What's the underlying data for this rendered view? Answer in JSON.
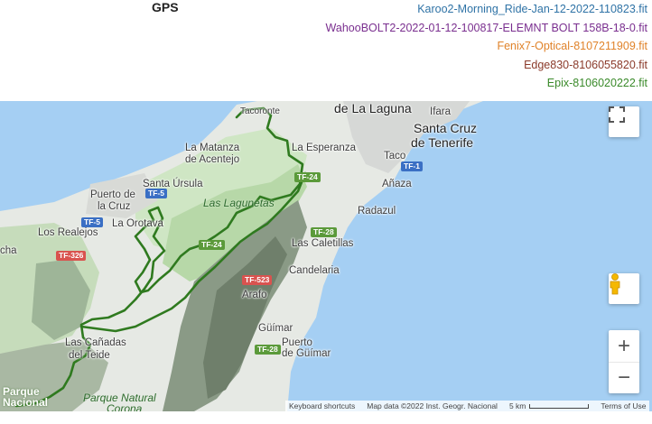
{
  "title": "GPS",
  "legend": [
    {
      "label": "Karoo2-Morning_Ride-Jan-12-2022-110823.fit",
      "color": "#2f73a6"
    },
    {
      "label": "WahooBOLT2-2022-01-12-100817-ELEMNT BOLT 158B-18-0.fit",
      "color": "#7a2f8f"
    },
    {
      "label": "Fenix7-Optical-8107211909.fit",
      "color": "#e0832a"
    },
    {
      "label": "Edge830-8106055820.fit",
      "color": "#8b3a2a"
    },
    {
      "label": "Epix-8106020222.fit",
      "color": "#3a8a2a"
    }
  ],
  "map": {
    "places": {
      "la_laguna": "de La Laguna",
      "santa_cruz_1": "Santa Cruz",
      "santa_cruz_2": "de Tenerife",
      "tacoronte": "Tacoronte",
      "matanza_1": "La Matanza",
      "matanza_2": "de Acentejo",
      "esperanza": "La Esperanza",
      "taco": "Taco",
      "anaza": "Añaza",
      "santa_ursula": "Santa Úrsula",
      "puerto_1": "Puerto de",
      "puerto_2": "la Cruz",
      "orotava": "La Orotava",
      "realejos": "Los Realejos",
      "las_lagunetas": "Las Lagunetas",
      "radazul": "Radazul",
      "caletillas": "Las Caletillas",
      "candelaria": "Candelaria",
      "arafo": "Arafo",
      "guimar": "Güímar",
      "puerto_guimar_1": "Puerto",
      "puerto_guimar_2": "de Güímar",
      "canadas_1": "Las Cañadas",
      "canadas_2": "del Teide",
      "parque_1": "Parque Natural",
      "parque_2": "Corona",
      "parque_nacional_1": "Parque",
      "parque_nacional_2": "Nacional",
      "icod": "cha",
      "ifara": "Ifara"
    },
    "roads": {
      "tf1": "TF-1",
      "tf5a": "TF-5",
      "tf5b": "TF-5",
      "tf24a": "TF-24",
      "tf24b": "TF-24",
      "tf24c": "TF-24",
      "tf28a": "TF-28",
      "tf28b": "TF-28",
      "tf523": "TF-523",
      "tf326": "TF-326"
    },
    "track_color": "#2f7a1f",
    "footer": {
      "shortcuts": "Keyboard shortcuts",
      "attribution": "Map data ©2022 Inst. Geogr. Nacional",
      "scale": "5 km",
      "terms": "Terms of Use"
    },
    "controls": {
      "fullscreen_icon": "fullscreen-icon",
      "pegman_icon": "pegman-icon",
      "zoom_in": "+",
      "zoom_out": "−"
    }
  }
}
